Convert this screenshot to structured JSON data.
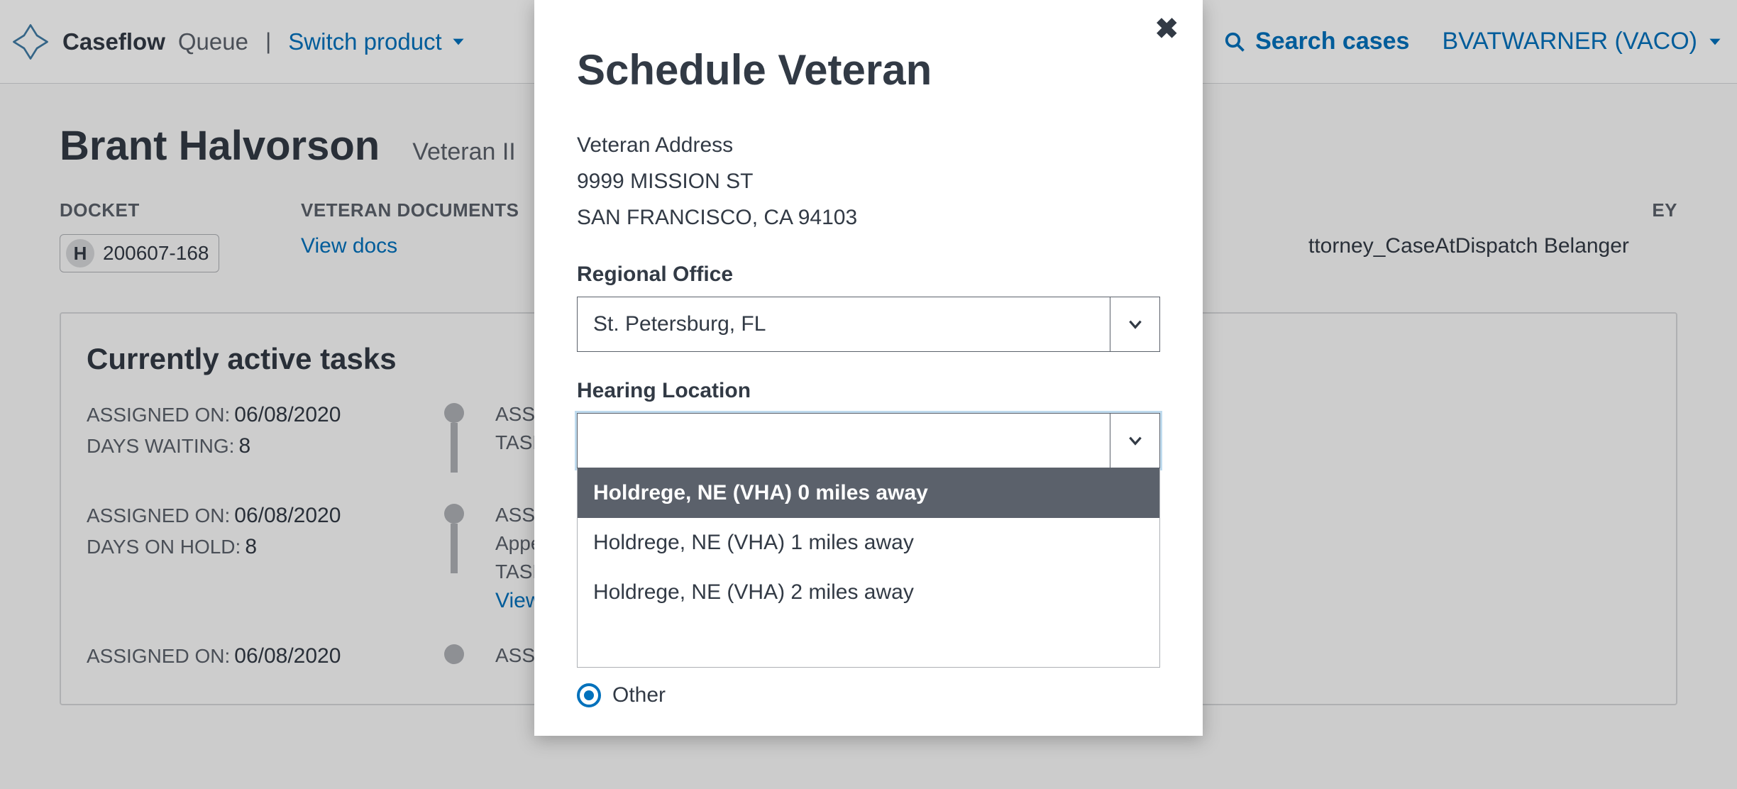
{
  "header": {
    "brand": "Caseflow",
    "brand_sub": "Queue",
    "switch_label": "Switch product",
    "search_label": "Search cases",
    "user_label": "BVATWARNER (VACO)"
  },
  "page": {
    "veteran_name": "Brant Halvorson",
    "veteran_id_label": "Veteran II",
    "info": {
      "docket_label": "DOCKET",
      "docket_letter": "H",
      "docket_number": "200607-168",
      "documents_label": "VETERAN DOCUMENTS",
      "view_docs": "View docs",
      "attorney_label_suffix": "EY",
      "attorney_value": "ttorney_CaseAtDispatch Belanger"
    },
    "tasks": {
      "title": "Currently active tasks",
      "rows": [
        {
          "assigned_on_label": "ASSIGNED ON:",
          "assigned_on": "06/08/2020",
          "wait_label": "DAYS WAITING:",
          "wait_value": "8",
          "right_label": "ASSIG",
          "right_task": "TASK:"
        },
        {
          "assigned_on_label": "ASSIGNED ON:",
          "assigned_on": "06/08/2020",
          "wait_label": "DAYS ON HOLD:",
          "wait_value": "8",
          "right_label": "ASSIG",
          "right_body": "Appe",
          "right_task": "TASK:",
          "right_link": "View"
        },
        {
          "assigned_on_label": "ASSIGNED ON:",
          "assigned_on": "06/08/2020",
          "right_label": "ASSIG"
        }
      ]
    }
  },
  "modal": {
    "title": "Schedule Veteran",
    "address_label": "Veteran Address",
    "address_line1": "9999 MISSION ST",
    "address_line2": "SAN FRANCISCO, CA 94103",
    "regional_office_label": "Regional Office",
    "regional_office_value": "St. Petersburg, FL",
    "hearing_location_label": "Hearing Location",
    "hearing_location_value": "",
    "hearing_options": [
      "Holdrege, NE (VHA) 0 miles away",
      "Holdrege, NE (VHA) 1 miles away",
      "Holdrege, NE (VHA) 2 miles away"
    ],
    "radio_other": "Other"
  }
}
